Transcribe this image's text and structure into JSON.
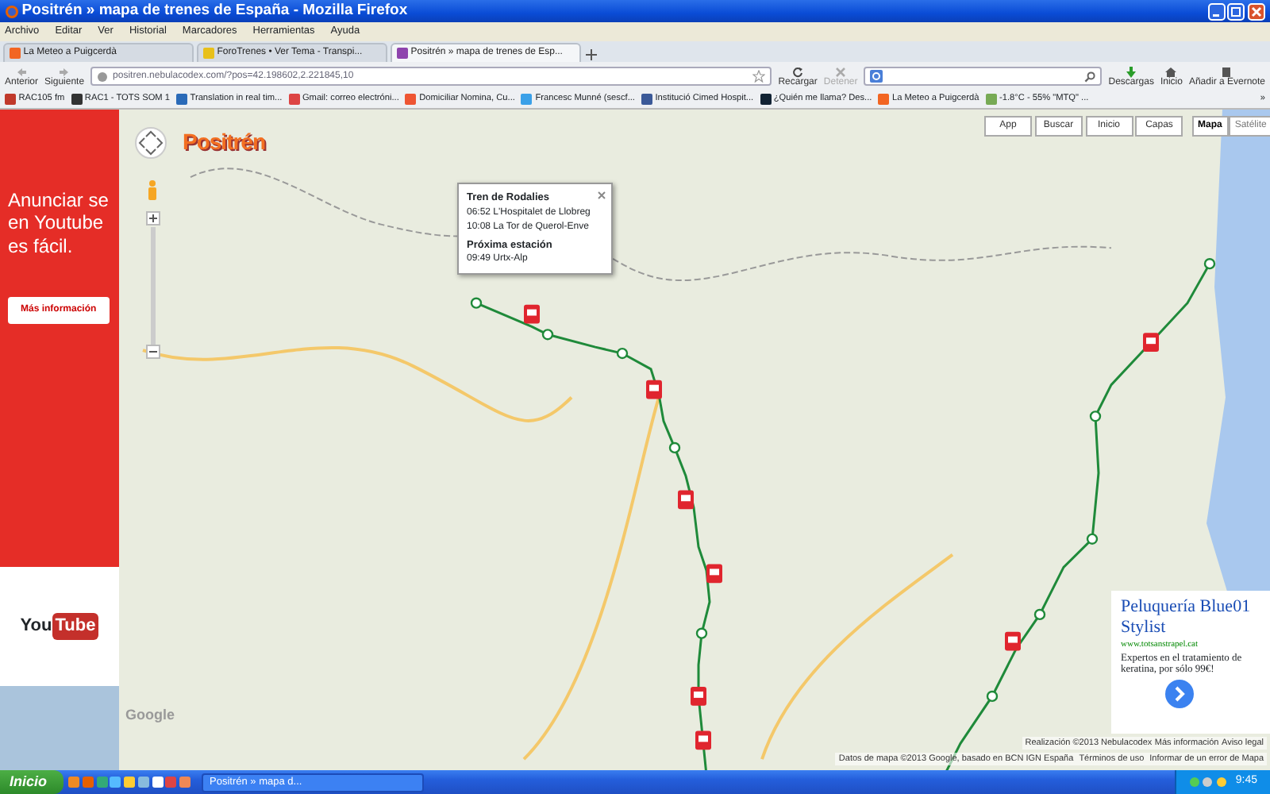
{
  "window": {
    "title": "Positrén » mapa de trenes de España - Mozilla Firefox"
  },
  "menu": [
    "Archivo",
    "Editar",
    "Ver",
    "Historial",
    "Marcadores",
    "Herramientas",
    "Ayuda"
  ],
  "tabs": [
    {
      "label": "La Meteo a Puigcerdà",
      "selected": false
    },
    {
      "label": "ForoTrenes • Ver Tema - Transpi...",
      "selected": false
    },
    {
      "label": "Positrén » mapa de trenes de Esp...",
      "selected": true
    }
  ],
  "toolbar": {
    "back": "Anterior",
    "forward": "Siguiente",
    "url": "positren.nebulacodex.com/?pos=42.198602,2.221845,10",
    "reload": "Recargar",
    "stop": "Detener",
    "stop_disabled": true,
    "downloads": "Descargas",
    "home": "Inicio",
    "evernote": "Añadir a Evernote"
  },
  "bookmarks": [
    "RAC105 fm",
    "RAC1 - TOTS SOM 1",
    "Translation in real tim...",
    "Gmail: correo electróni...",
    "Domiciliar Nomina, Cu...",
    "Francesc Munné (sescf...",
    "Institució Cimed Hospit...",
    "¿Quién me llama? Des...",
    "La Meteo a Puigcerdà",
    "-1.8°C - 55% \"MTQ\" ..."
  ],
  "bookmarks_more": "»",
  "ad_left": {
    "text": "Anunciar se en Youtube es fácil.",
    "button": "Más información",
    "logo_you": "You",
    "logo_tube": "Tube"
  },
  "map": {
    "logo": "Positrén",
    "buttons": [
      "App",
      "Buscar",
      "Inicio",
      "Capas"
    ],
    "map_types": [
      {
        "label": "Mapa",
        "selected": true
      },
      {
        "label": "Satélite",
        "selected": false
      }
    ],
    "popup": {
      "title": "Tren de Rodalies",
      "lines": [
        "06:52 L'Hospitalet de Llobreg",
        "10:08 La Tor de Querol-Enve"
      ],
      "next_heading": "Próxima estación",
      "next": "09:49 Urtx-Alp"
    },
    "google": "Google",
    "credits": [
      "Realización ©2013 Nebulacodex",
      "Más información",
      "Aviso legal"
    ],
    "data_credits": [
      "Datos de mapa ©2013 Google, basado en BCN IGN España",
      "Términos de uso",
      "Informar de un error de Mapa"
    ]
  },
  "ad_right": {
    "title": "Peluquería Blue01 Stylist",
    "url": "www.totsanstrapel.cat",
    "text": "Expertos en el tratamiento de keratina, por sólo 99€!"
  },
  "taskbar": {
    "start": "Inicio",
    "window": "Positrén » mapa d...",
    "clock": "9:45"
  }
}
